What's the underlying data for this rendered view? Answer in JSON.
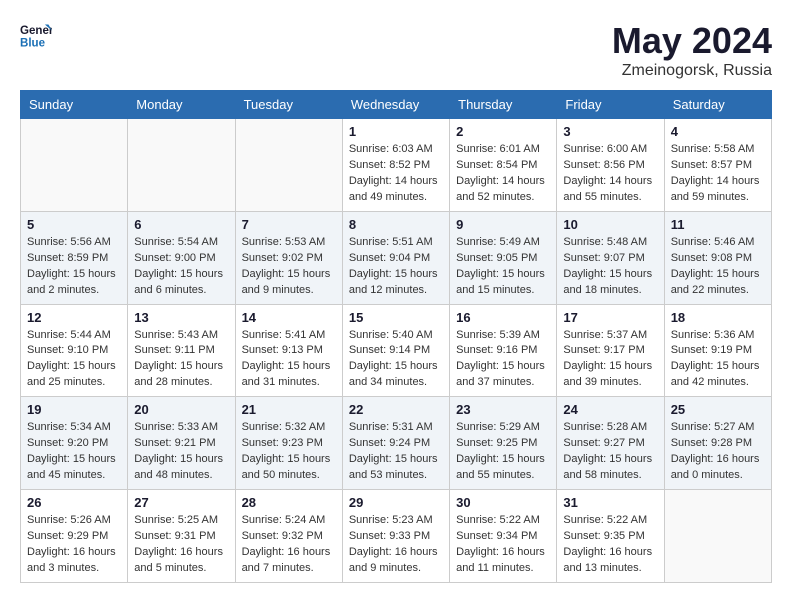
{
  "header": {
    "logo_line1": "General",
    "logo_line2": "Blue",
    "month_title": "May 2024",
    "location": "Zmeinogorsk, Russia"
  },
  "weekdays": [
    "Sunday",
    "Monday",
    "Tuesday",
    "Wednesday",
    "Thursday",
    "Friday",
    "Saturday"
  ],
  "weeks": [
    [
      {
        "day": "",
        "info": ""
      },
      {
        "day": "",
        "info": ""
      },
      {
        "day": "",
        "info": ""
      },
      {
        "day": "1",
        "info": "Sunrise: 6:03 AM\nSunset: 8:52 PM\nDaylight: 14 hours\nand 49 minutes."
      },
      {
        "day": "2",
        "info": "Sunrise: 6:01 AM\nSunset: 8:54 PM\nDaylight: 14 hours\nand 52 minutes."
      },
      {
        "day": "3",
        "info": "Sunrise: 6:00 AM\nSunset: 8:56 PM\nDaylight: 14 hours\nand 55 minutes."
      },
      {
        "day": "4",
        "info": "Sunrise: 5:58 AM\nSunset: 8:57 PM\nDaylight: 14 hours\nand 59 minutes."
      }
    ],
    [
      {
        "day": "5",
        "info": "Sunrise: 5:56 AM\nSunset: 8:59 PM\nDaylight: 15 hours\nand 2 minutes."
      },
      {
        "day": "6",
        "info": "Sunrise: 5:54 AM\nSunset: 9:00 PM\nDaylight: 15 hours\nand 6 minutes."
      },
      {
        "day": "7",
        "info": "Sunrise: 5:53 AM\nSunset: 9:02 PM\nDaylight: 15 hours\nand 9 minutes."
      },
      {
        "day": "8",
        "info": "Sunrise: 5:51 AM\nSunset: 9:04 PM\nDaylight: 15 hours\nand 12 minutes."
      },
      {
        "day": "9",
        "info": "Sunrise: 5:49 AM\nSunset: 9:05 PM\nDaylight: 15 hours\nand 15 minutes."
      },
      {
        "day": "10",
        "info": "Sunrise: 5:48 AM\nSunset: 9:07 PM\nDaylight: 15 hours\nand 18 minutes."
      },
      {
        "day": "11",
        "info": "Sunrise: 5:46 AM\nSunset: 9:08 PM\nDaylight: 15 hours\nand 22 minutes."
      }
    ],
    [
      {
        "day": "12",
        "info": "Sunrise: 5:44 AM\nSunset: 9:10 PM\nDaylight: 15 hours\nand 25 minutes."
      },
      {
        "day": "13",
        "info": "Sunrise: 5:43 AM\nSunset: 9:11 PM\nDaylight: 15 hours\nand 28 minutes."
      },
      {
        "day": "14",
        "info": "Sunrise: 5:41 AM\nSunset: 9:13 PM\nDaylight: 15 hours\nand 31 minutes."
      },
      {
        "day": "15",
        "info": "Sunrise: 5:40 AM\nSunset: 9:14 PM\nDaylight: 15 hours\nand 34 minutes."
      },
      {
        "day": "16",
        "info": "Sunrise: 5:39 AM\nSunset: 9:16 PM\nDaylight: 15 hours\nand 37 minutes."
      },
      {
        "day": "17",
        "info": "Sunrise: 5:37 AM\nSunset: 9:17 PM\nDaylight: 15 hours\nand 39 minutes."
      },
      {
        "day": "18",
        "info": "Sunrise: 5:36 AM\nSunset: 9:19 PM\nDaylight: 15 hours\nand 42 minutes."
      }
    ],
    [
      {
        "day": "19",
        "info": "Sunrise: 5:34 AM\nSunset: 9:20 PM\nDaylight: 15 hours\nand 45 minutes."
      },
      {
        "day": "20",
        "info": "Sunrise: 5:33 AM\nSunset: 9:21 PM\nDaylight: 15 hours\nand 48 minutes."
      },
      {
        "day": "21",
        "info": "Sunrise: 5:32 AM\nSunset: 9:23 PM\nDaylight: 15 hours\nand 50 minutes."
      },
      {
        "day": "22",
        "info": "Sunrise: 5:31 AM\nSunset: 9:24 PM\nDaylight: 15 hours\nand 53 minutes."
      },
      {
        "day": "23",
        "info": "Sunrise: 5:29 AM\nSunset: 9:25 PM\nDaylight: 15 hours\nand 55 minutes."
      },
      {
        "day": "24",
        "info": "Sunrise: 5:28 AM\nSunset: 9:27 PM\nDaylight: 15 hours\nand 58 minutes."
      },
      {
        "day": "25",
        "info": "Sunrise: 5:27 AM\nSunset: 9:28 PM\nDaylight: 16 hours\nand 0 minutes."
      }
    ],
    [
      {
        "day": "26",
        "info": "Sunrise: 5:26 AM\nSunset: 9:29 PM\nDaylight: 16 hours\nand 3 minutes."
      },
      {
        "day": "27",
        "info": "Sunrise: 5:25 AM\nSunset: 9:31 PM\nDaylight: 16 hours\nand 5 minutes."
      },
      {
        "day": "28",
        "info": "Sunrise: 5:24 AM\nSunset: 9:32 PM\nDaylight: 16 hours\nand 7 minutes."
      },
      {
        "day": "29",
        "info": "Sunrise: 5:23 AM\nSunset: 9:33 PM\nDaylight: 16 hours\nand 9 minutes."
      },
      {
        "day": "30",
        "info": "Sunrise: 5:22 AM\nSunset: 9:34 PM\nDaylight: 16 hours\nand 11 minutes."
      },
      {
        "day": "31",
        "info": "Sunrise: 5:22 AM\nSunset: 9:35 PM\nDaylight: 16 hours\nand 13 minutes."
      },
      {
        "day": "",
        "info": ""
      }
    ]
  ]
}
